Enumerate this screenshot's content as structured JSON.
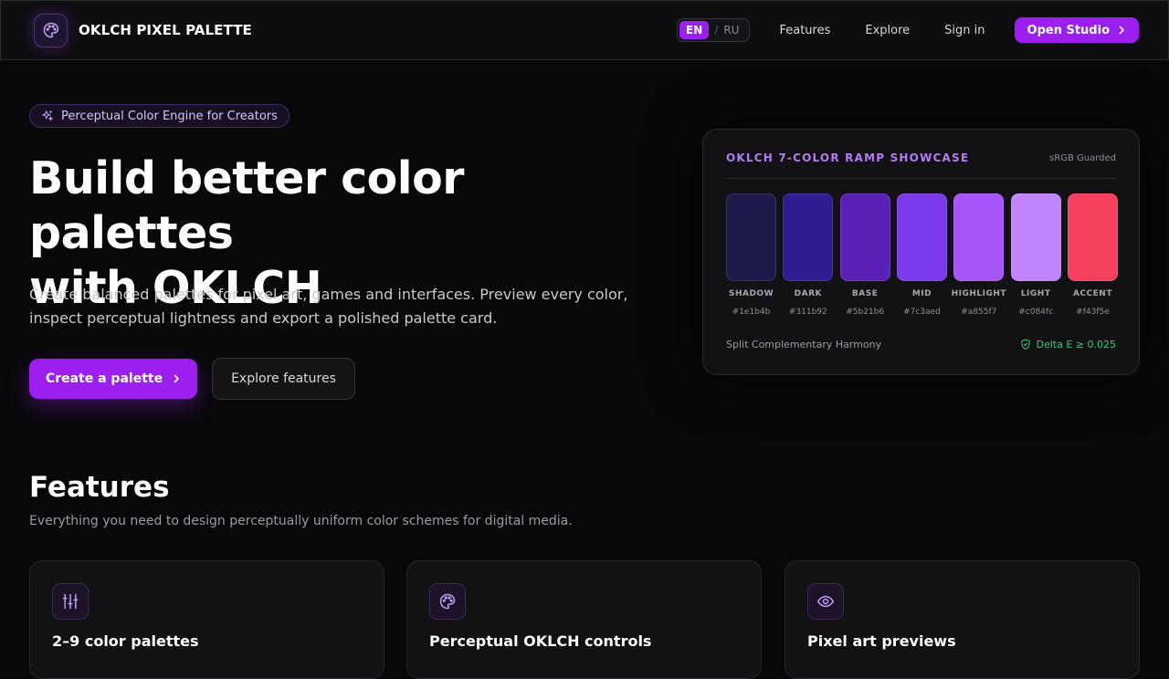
{
  "nav": {
    "brand": "OKLCH PIXEL PALETTE",
    "logo_icon": "palette-icon",
    "lang_active": "EN",
    "lang_sep": "/",
    "lang_other": "RU",
    "links": [
      "Features",
      "Explore",
      "Sign in"
    ],
    "cta": "Open Studio"
  },
  "hero": {
    "badge": "Perceptual Color Engine for Creators",
    "title_line1": "Build better color palettes",
    "title_line2": "with OKLCH",
    "subtitle": "Create balanced palettes for pixel art, games and interfaces. Preview every color, inspect perceptual lightness and export a polished palette card.",
    "primary_button": "Create a palette",
    "secondary_button": "Explore features"
  },
  "showcase": {
    "title": "OKLCH 7-COLOR RAMP SHOWCASE",
    "tag": "sRGB Guarded",
    "swatches": [
      {
        "name": "SHADOW",
        "hex": "#1e1b4b"
      },
      {
        "name": "DARK",
        "hex": "#311b92"
      },
      {
        "name": "BASE",
        "hex": "#5b21b6"
      },
      {
        "name": "MID",
        "hex": "#7c3aed"
      },
      {
        "name": "HIGHLIGHT",
        "hex": "#a855f7"
      },
      {
        "name": "LIGHT",
        "hex": "#c084fc"
      },
      {
        "name": "ACCENT",
        "hex": "#f43f5e"
      }
    ],
    "harmony": "Split Complementary Harmony",
    "delta": "Delta E ≥ 0.025"
  },
  "features": {
    "title": "Features",
    "subtitle": "Everything you need to design perceptually uniform color schemes for digital media.",
    "cards": [
      {
        "icon": "sliders-icon",
        "name": "2–9 color palettes"
      },
      {
        "icon": "palette-icon",
        "name": "Perceptual OKLCH controls"
      },
      {
        "icon": "eye-icon",
        "name": "Pixel art previews"
      }
    ]
  },
  "colors": {
    "accent": "#9d1ff0",
    "background": "#08080a",
    "success": "#3cc47c"
  }
}
